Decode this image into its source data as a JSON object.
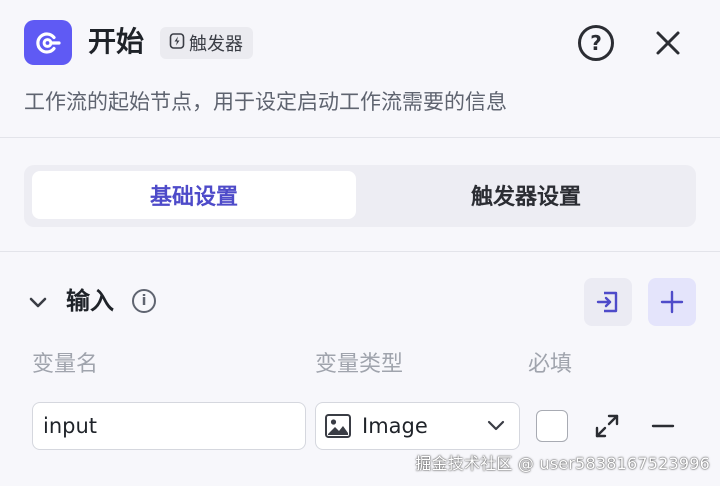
{
  "header": {
    "title": "开始",
    "badge_label": "触发器",
    "description": "工作流的起始节点，用于设定启动工作流需要的信息",
    "help_glyph": "?"
  },
  "tabs": [
    {
      "label": "基础设置",
      "active": true
    },
    {
      "label": "触发器设置",
      "active": false
    }
  ],
  "input_section": {
    "title": "输入",
    "info_glyph": "i",
    "columns": {
      "name": "变量名",
      "type": "变量类型",
      "required": "必填"
    },
    "rows": [
      {
        "name_value": "input",
        "type_value": "Image",
        "required": false
      }
    ]
  },
  "watermark": "掘金技术社区 @ user5838167523996",
  "colors": {
    "accent": "#5f5af4",
    "active_tab_text": "#4e4bc9",
    "background": "#f7f7fb"
  }
}
